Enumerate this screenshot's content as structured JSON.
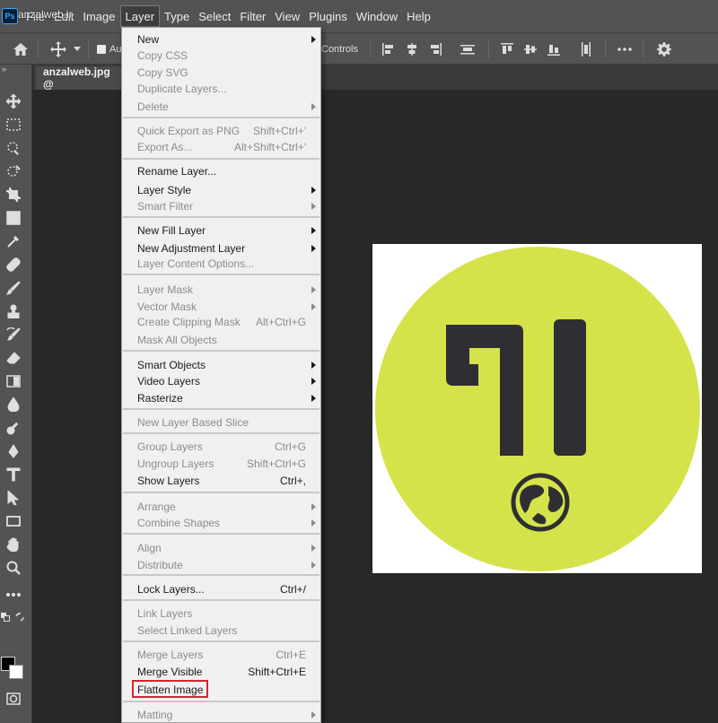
{
  "app": {
    "logo_text": "Ps",
    "watermark": "anzalweb.ir"
  },
  "menubar": {
    "items": [
      "File",
      "Edit",
      "Image",
      "Layer",
      "Type",
      "Select",
      "Filter",
      "View",
      "Plugins",
      "Window",
      "Help"
    ],
    "active": "Layer"
  },
  "optionsbar": {
    "auto_label": "Au",
    "controls_label": "Controls"
  },
  "document": {
    "tab_title": "anzalweb.jpg @"
  },
  "icons": {
    "home": "home-icon",
    "move": "move-icon",
    "settings": "gear-icon",
    "more": "more-icon"
  },
  "colors": {
    "logo_circle": "#d5e34a",
    "logo_glyph": "#2f2f33",
    "highlight": "#d0262d",
    "foreground_swatch": "#000000",
    "background_swatch": "#ffffff"
  },
  "layer_menu": {
    "new": {
      "label": "New"
    },
    "copy_css": {
      "label": "Copy CSS"
    },
    "copy_svg": {
      "label": "Copy SVG"
    },
    "duplicate_layers": {
      "label": "Duplicate Layers..."
    },
    "delete": {
      "label": "Delete"
    },
    "quick_export": {
      "label": "Quick Export as PNG",
      "shortcut": "Shift+Ctrl+'"
    },
    "export_as": {
      "label": "Export As...",
      "shortcut": "Alt+Shift+Ctrl+'"
    },
    "rename_layer": {
      "label": "Rename Layer..."
    },
    "layer_style": {
      "label": "Layer Style"
    },
    "smart_filter": {
      "label": "Smart Filter"
    },
    "new_fill_layer": {
      "label": "New Fill Layer"
    },
    "new_adjustment_layer": {
      "label": "New Adjustment Layer"
    },
    "layer_content_options": {
      "label": "Layer Content Options..."
    },
    "layer_mask": {
      "label": "Layer Mask"
    },
    "vector_mask": {
      "label": "Vector Mask"
    },
    "create_clipping_mask": {
      "label": "Create Clipping Mask",
      "shortcut": "Alt+Ctrl+G"
    },
    "mask_all_objects": {
      "label": "Mask All Objects"
    },
    "smart_objects": {
      "label": "Smart Objects"
    },
    "video_layers": {
      "label": "Video Layers"
    },
    "rasterize": {
      "label": "Rasterize"
    },
    "new_layer_based_slice": {
      "label": "New Layer Based Slice"
    },
    "group_layers": {
      "label": "Group Layers",
      "shortcut": "Ctrl+G"
    },
    "ungroup_layers": {
      "label": "Ungroup Layers",
      "shortcut": "Shift+Ctrl+G"
    },
    "show_layers": {
      "label": "Show Layers",
      "shortcut": "Ctrl+,"
    },
    "arrange": {
      "label": "Arrange"
    },
    "combine_shapes": {
      "label": "Combine Shapes"
    },
    "align": {
      "label": "Align"
    },
    "distribute": {
      "label": "Distribute"
    },
    "lock_layers": {
      "label": "Lock Layers...",
      "shortcut": "Ctrl+/"
    },
    "link_layers": {
      "label": "Link Layers"
    },
    "select_linked_layers": {
      "label": "Select Linked Layers"
    },
    "merge_layers": {
      "label": "Merge Layers",
      "shortcut": "Ctrl+E"
    },
    "merge_visible": {
      "label": "Merge Visible",
      "shortcut": "Shift+Ctrl+E"
    },
    "flatten_image": {
      "label": "Flatten Image"
    },
    "matting": {
      "label": "Matting"
    }
  }
}
